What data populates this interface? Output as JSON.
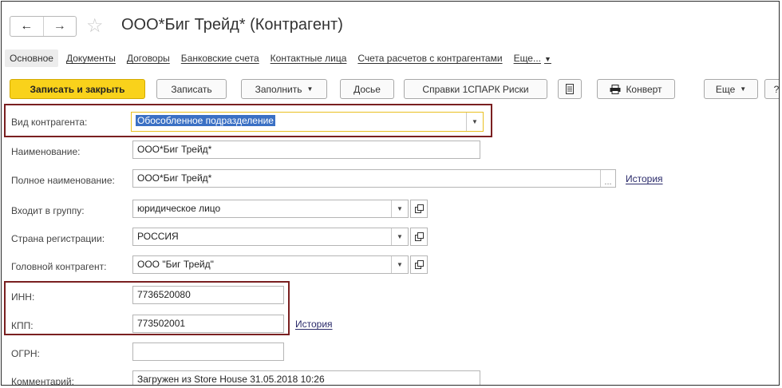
{
  "window": {
    "title": "ООО*Биг Трейд* (Контрагент)",
    "back_glyph": "←",
    "forward_glyph": "→",
    "star_glyph": "☆"
  },
  "tabs": [
    {
      "label": "Основное",
      "active": true
    },
    {
      "label": "Документы"
    },
    {
      "label": "Договоры"
    },
    {
      "label": "Банковские счета"
    },
    {
      "label": "Контактные лица"
    },
    {
      "label": "Счета расчетов с контрагентами"
    },
    {
      "label": "Еще..."
    }
  ],
  "toolbar": {
    "save_close": "Записать и закрыть",
    "save": "Записать",
    "fill": "Заполнить",
    "dossier": "Досье",
    "spark": "Справки 1СПАРК Риски",
    "envelope": "Конверт",
    "more": "Еще",
    "help": "?"
  },
  "form": {
    "kind_label": "Вид контрагента:",
    "kind_value": "Обособленное подразделение",
    "name_label": "Наименование:",
    "name_value": "ООО*Биг Трейд*",
    "full_name_label": "Полное наименование:",
    "full_name_value": "ООО*Биг Трейд*",
    "group_label": "Входит в группу:",
    "group_value": "юридическое лицо",
    "country_label": "Страна регистрации:",
    "country_value": "РОССИЯ",
    "head_label": "Головной контрагент:",
    "head_value": "ООО \"Биг Трейд\"",
    "inn_label": "ИНН:",
    "inn_value": "7736520080",
    "kpp_label": "КПП:",
    "kpp_value": "773502001",
    "ogrn_label": "ОГРН:",
    "ogrn_value": "",
    "comment_label": "Комментарий:",
    "comment_value": "Загружен из Store House 31.05.2018 10:26",
    "history_link": "История"
  },
  "colors": {
    "primary_button": "#f9d21b",
    "highlight_frame": "#7a1f20",
    "selection": "#3b70c4",
    "focus_border": "#eac021"
  }
}
